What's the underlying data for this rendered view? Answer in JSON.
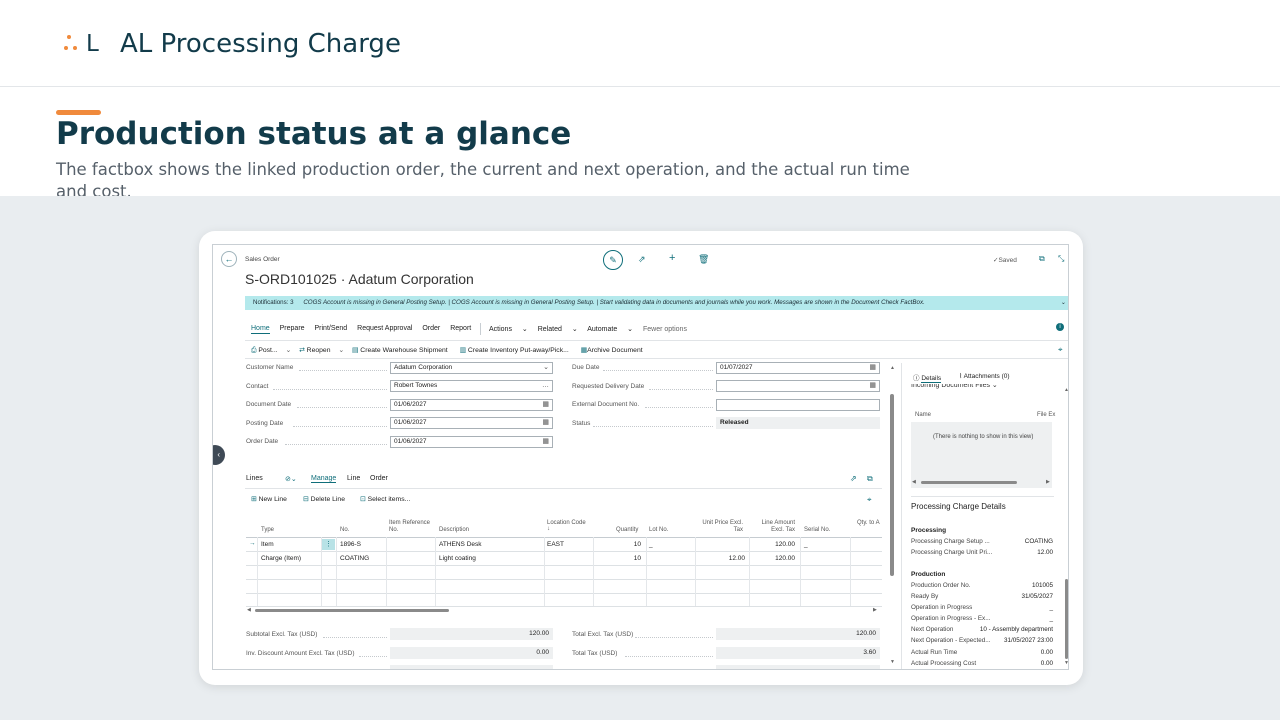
{
  "slide": {
    "brand": "AL Processing Charge",
    "heading": "Production status at a glance",
    "subtitle": "The factbox shows the linked production order, the current and next operation, and the actual run time and cost."
  },
  "colors": {
    "accent": "#f08a3c",
    "brand": "#123b4a",
    "teal": "#0f6e7a",
    "notification": "#b4e9ec"
  },
  "page": {
    "kind": "Sales Order",
    "title": "S-ORD101025 · Adatum Corporation",
    "saved_label": "Saved",
    "notification": {
      "count": "Notifications: 3",
      "text": "COGS Account is missing in General Posting Setup.  |  COGS Account is missing in General Posting Setup.  |  Start validating data in documents and journals while you work. Messages are shown in the Document Check FactBox."
    }
  },
  "actions": {
    "home": "Home",
    "prepare": "Prepare",
    "print_send": "Print/Send",
    "request_approval": "Request Approval",
    "order": "Order",
    "report": "Report",
    "actions": "Actions",
    "related": "Related",
    "automate": "Automate",
    "fewer": "Fewer options"
  },
  "promoted": {
    "post": "Post...",
    "reopen": "Reopen",
    "create_shipment": "Create Warehouse Shipment",
    "create_putaway": "Create Inventory Put-away/Pick...",
    "archive": "Archive Document"
  },
  "form": {
    "customer_name_label": "Customer Name",
    "customer_name": "Adatum Corporation",
    "contact_label": "Contact",
    "contact": "Robert Townes",
    "document_date_label": "Document Date",
    "document_date": "01/06/2027",
    "posting_date_label": "Posting Date",
    "posting_date": "01/06/2027",
    "order_date_label": "Order Date",
    "order_date": "01/06/2027",
    "due_date_label": "Due Date",
    "due_date": "01/07/2027",
    "requested_delivery_label": "Requested Delivery Date",
    "requested_delivery": "",
    "external_doc_label": "External Document No.",
    "external_doc": "",
    "status_label": "Status",
    "status": "Released"
  },
  "lines": {
    "title": "Lines",
    "manage": "Manage",
    "line": "Line",
    "order": "Order",
    "new_line": "New Line",
    "delete_line": "Delete Line",
    "select_items": "Select items...",
    "headers": {
      "type": "Type",
      "no": "No.",
      "item_ref": "Item Reference No.",
      "description": "Description",
      "location": "Location Code",
      "quantity": "Quantity",
      "lot": "Lot No.",
      "unit_price": "Unit Price Excl. Tax",
      "line_amount": "Line Amount Excl. Tax",
      "serial": "Serial No.",
      "qty_to": "Qty. to A"
    },
    "rows": [
      {
        "type": "Item",
        "no": "1896-S",
        "description": "ATHENS Desk",
        "location": "EAST",
        "quantity": "10",
        "lot": "_",
        "unit_price": "",
        "line_amount": "120.00",
        "serial": "_"
      },
      {
        "type": "Charge (Item)",
        "no": "COATING",
        "description": "Light coating",
        "location": "",
        "quantity": "10",
        "lot": "",
        "unit_price": "12.00",
        "line_amount": "120.00",
        "serial": ""
      }
    ]
  },
  "totals": {
    "subtotal_label": "Subtotal Excl. Tax (USD)",
    "subtotal": "120.00",
    "inv_discount_label": "Inv. Discount Amount Excl. Tax (USD)",
    "inv_discount": "0.00",
    "total_excl_label": "Total Excl. Tax (USD)",
    "total_excl": "120.00",
    "total_tax_label": "Total Tax (USD)",
    "total_tax": "3.60"
  },
  "factbox": {
    "details_tab": "Details",
    "attachments_tab": "Attachments (0)",
    "incoming_title": "Incoming Document Files",
    "col_name": "Name",
    "col_file": "File Ex",
    "empty": "(There is nothing to show in this view)",
    "title": "Processing Charge Details",
    "processing_section": "Processing",
    "setup_label": "Processing Charge Setup ...",
    "setup_value": "COATING",
    "unit_price_label": "Processing Charge Unit Pri...",
    "unit_price_value": "12.00",
    "production_section": "Production",
    "prod_order_label": "Production Order No.",
    "prod_order_value": "101005",
    "ready_by_label": "Ready By",
    "ready_by_value": "31/05/2027",
    "op_progress_label": "Operation in Progress",
    "op_progress_value": "_",
    "op_progress_ex_label": "Operation in Progress - Ex...",
    "op_progress_ex_value": "_",
    "next_op_label": "Next Operation",
    "next_op_value": "10 - Assembly department",
    "next_op_expected_label": "Next Operation - Expected...",
    "next_op_expected_value": "31/05/2027 23:00",
    "run_time_label": "Actual Run Time",
    "run_time_value": "0.00",
    "proc_cost_label": "Actual Processing Cost",
    "proc_cost_value": "0.00"
  }
}
